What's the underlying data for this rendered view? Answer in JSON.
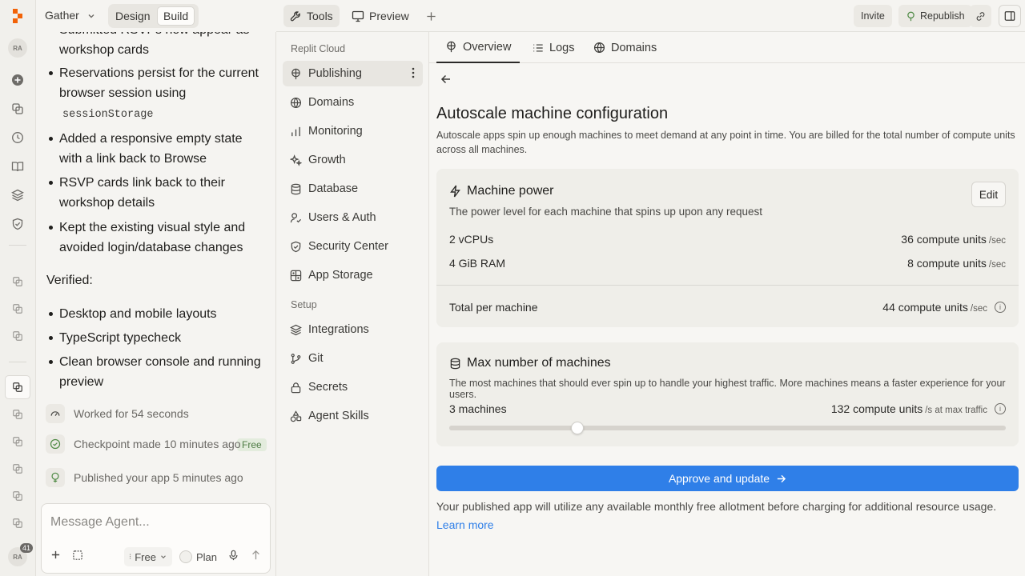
{
  "header": {
    "project_name": "Gather",
    "mode_design": "Design",
    "mode_build": "Build"
  },
  "rail": {
    "avatar_top": "RA",
    "avatar_bottom": "RA",
    "notification_count": "41"
  },
  "chat": {
    "cutoff_line": "Submitted RSVPs now appear as",
    "lines": [
      "workshop cards",
      "Reservations persist for the current",
      "browser session using",
      "Added a responsive empty state",
      "with a link back to Browse",
      "RSVP cards link back to their",
      "workshop details",
      "Kept the existing visual style and",
      "avoided login/database changes"
    ],
    "code_token": "sessionStorage",
    "verified_label": "Verified:",
    "verified_lines": [
      "Desktop and mobile layouts",
      "TypeScript typecheck",
      "Clean browser console and running",
      "preview"
    ],
    "status": [
      {
        "text": "Worked for 54 seconds",
        "icon": "gauge-icon"
      },
      {
        "text": "Checkpoint made 10 minutes ago",
        "icon": "check-circle-icon"
      },
      {
        "text": "Published your app 5 minutes ago",
        "icon": "publish-icon"
      }
    ],
    "free_badge": "Free",
    "composer_placeholder": "Message Agent...",
    "composer_free": "Free",
    "composer_plan": "Plan"
  },
  "topbar": {
    "tools": "Tools",
    "preview": "Preview",
    "invite": "Invite",
    "republish": "Republish"
  },
  "menu": {
    "section_replit": "Replit Cloud",
    "items": [
      "Publishing",
      "Domains",
      "Monitoring",
      "Growth",
      "Database",
      "Users & Auth",
      "Security Center",
      "App Storage"
    ],
    "section_setup": "Setup",
    "setup_items": [
      "Integrations",
      "Git",
      "Secrets",
      "Agent Skills"
    ]
  },
  "main": {
    "tabs": [
      "Overview",
      "Logs",
      "Domains"
    ],
    "title": "Autoscale machine configuration",
    "description": "Autoscale apps spin up enough machines to meet demand at any point in time. You are billed for the total number of compute units across all machines.",
    "power": {
      "title": "Machine power",
      "subtitle": "The power level for each machine that spins up upon any request",
      "edit": "Edit",
      "rows": [
        {
          "label": "2 vCPUs",
          "value": "36 compute units",
          "unit": "/sec"
        },
        {
          "label": "4 GiB RAM",
          "value": "8 compute units",
          "unit": "/sec"
        }
      ],
      "total_label": "Total per machine",
      "total_value": "44 compute units",
      "total_unit": "/sec"
    },
    "machines": {
      "title": "Max number of machines",
      "subtitle": "The most machines that should ever spin up to handle your highest traffic. More machines means a faster experience for your users.",
      "count_label": "3 machines",
      "value": "132 compute units",
      "unit": "/s at max traffic",
      "slider_fraction": 0.23
    },
    "approve": "Approve and update",
    "footer": "Your published app will utilize any available monthly free allotment before charging for additional resource usage.",
    "learn_more": "Learn more"
  },
  "colors": {
    "accent": "#2f7fe8",
    "brand": "#f26207"
  }
}
